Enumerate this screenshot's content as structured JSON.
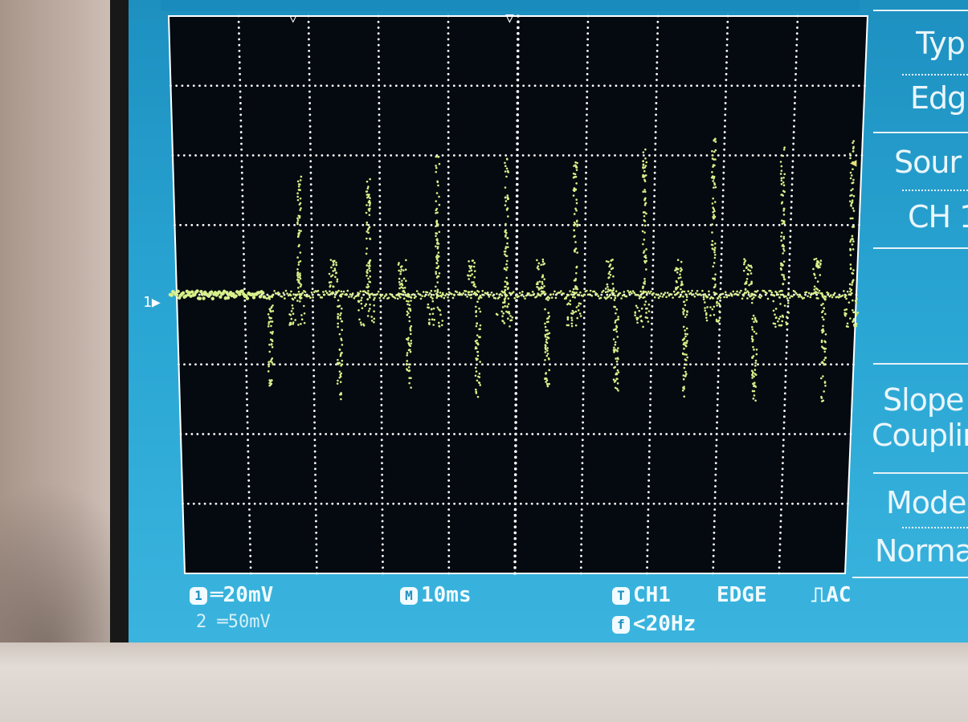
{
  "screen": {
    "trace_color": "#d8f08a",
    "grid_color": "#ffffff",
    "background": "#050a10"
  },
  "channel_marker": "1",
  "side_menu": {
    "items": [
      {
        "id": "type-label",
        "text": "Typ"
      },
      {
        "id": "type-value",
        "text": "Edg"
      },
      {
        "id": "source-label",
        "text": "Sour"
      },
      {
        "id": "source-value",
        "text": "CH 1"
      },
      {
        "id": "slope-coupling-label",
        "text": "Slope"
      },
      {
        "id": "coupling-label",
        "text": "Couplir"
      },
      {
        "id": "mode-label",
        "text": "Mode"
      },
      {
        "id": "mode-value",
        "text": "Norma"
      }
    ]
  },
  "status_bar": {
    "ch1_scale": "20mV",
    "ch2_scale": "50mV",
    "ch1_badge": "1",
    "ch2_badge": "2",
    "timebase_badge": "M",
    "timebase": "10ms",
    "trigger_badge": "T",
    "trigger_source": "CH1",
    "trigger_type": "EDGE",
    "trigger_coupling": "AC",
    "freq_badge": "f",
    "frequency": "<20Hz"
  },
  "waveform": {
    "description_source": "oscilloscope trace",
    "pulse_count": 9,
    "baseline_division": 4.0
  }
}
